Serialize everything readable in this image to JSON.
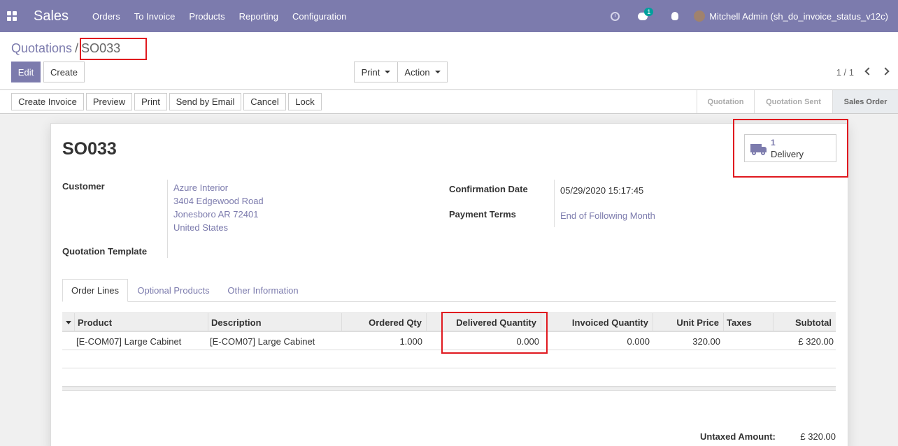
{
  "navbar": {
    "brand": "Sales",
    "menu": [
      "Orders",
      "To Invoice",
      "Products",
      "Reporting",
      "Configuration"
    ],
    "chat_count": "1",
    "user": "Mitchell Admin (sh_do_invoice_status_v12c)"
  },
  "breadcrumb": {
    "parent": "Quotations",
    "separator": "/",
    "current": "SO033"
  },
  "buttons": {
    "edit": "Edit",
    "create": "Create",
    "print": "Print",
    "action": "Action"
  },
  "pager": {
    "text": "1 / 1"
  },
  "statusbar": {
    "buttons": [
      "Create Invoice",
      "Preview",
      "Print",
      "Send by Email",
      "Cancel",
      "Lock"
    ],
    "stages": [
      "Quotation",
      "Quotation Sent",
      "Sales Order"
    ],
    "active_stage": "Sales Order"
  },
  "form": {
    "title": "SO033",
    "delivery": {
      "count": "1",
      "label": "Delivery"
    },
    "customer_label": "Customer",
    "customer_address": [
      "Azure Interior",
      "3404 Edgewood Road",
      "Jonesboro AR 72401",
      "United States"
    ],
    "template_label": "Quotation Template",
    "confirmation_date_label": "Confirmation Date",
    "confirmation_date": "05/29/2020 15:17:45",
    "payment_terms_label": "Payment Terms",
    "payment_terms": "End of Following Month"
  },
  "tabs": [
    "Order Lines",
    "Optional Products",
    "Other Information"
  ],
  "table": {
    "columns": [
      "Product",
      "Description",
      "Ordered Qty",
      "Delivered Quantity",
      "Invoiced Quantity",
      "Unit Price",
      "Taxes",
      "Subtotal"
    ],
    "rows": [
      {
        "product": "[E-COM07] Large Cabinet",
        "description": "[E-COM07] Large Cabinet",
        "ordered_qty": "1.000",
        "delivered_qty": "0.000",
        "invoiced_qty": "0.000",
        "unit_price": "320.00",
        "taxes": "",
        "subtotal": "£ 320.00"
      }
    ]
  },
  "totals": {
    "untaxed_label": "Untaxed Amount:",
    "untaxed_value": "£ 320.00"
  },
  "colors": {
    "brand": "#7c7bad",
    "highlight": "#e0191f",
    "badge": "#00a09d"
  }
}
